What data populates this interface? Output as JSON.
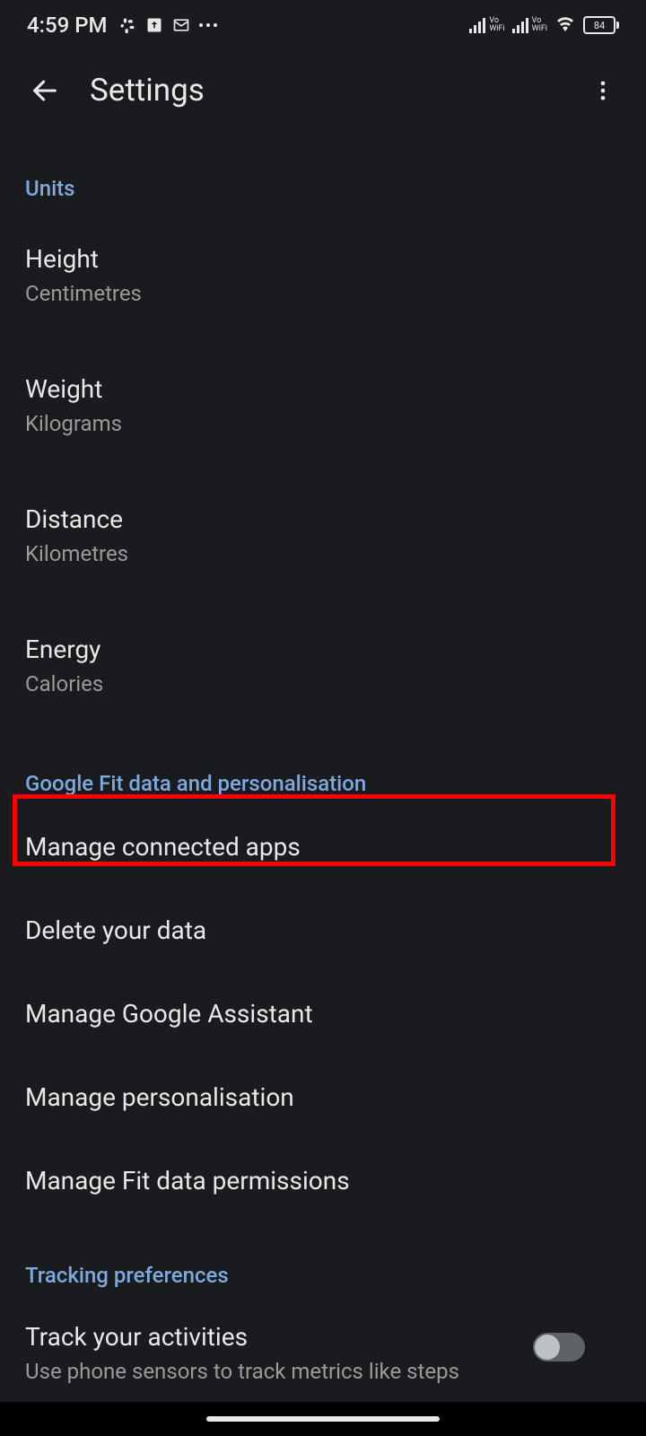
{
  "status_bar": {
    "time": "4:59 PM",
    "battery": "84"
  },
  "app_bar": {
    "title": "Settings"
  },
  "sections": {
    "units": {
      "header": "Units",
      "items": [
        {
          "title": "Height",
          "subtitle": "Centimetres"
        },
        {
          "title": "Weight",
          "subtitle": "Kilograms"
        },
        {
          "title": "Distance",
          "subtitle": "Kilometres"
        },
        {
          "title": "Energy",
          "subtitle": "Calories"
        }
      ]
    },
    "data": {
      "header": "Google Fit data and personalisation",
      "items": [
        {
          "title": "Manage connected apps"
        },
        {
          "title": "Delete your data"
        },
        {
          "title": "Manage Google Assistant"
        },
        {
          "title": "Manage personalisation"
        },
        {
          "title": "Manage Fit data permissions"
        }
      ]
    },
    "tracking": {
      "header": "Tracking preferences",
      "items": [
        {
          "title": "Track your activities",
          "subtitle": "Use phone sensors to track metrics like steps"
        }
      ]
    }
  }
}
